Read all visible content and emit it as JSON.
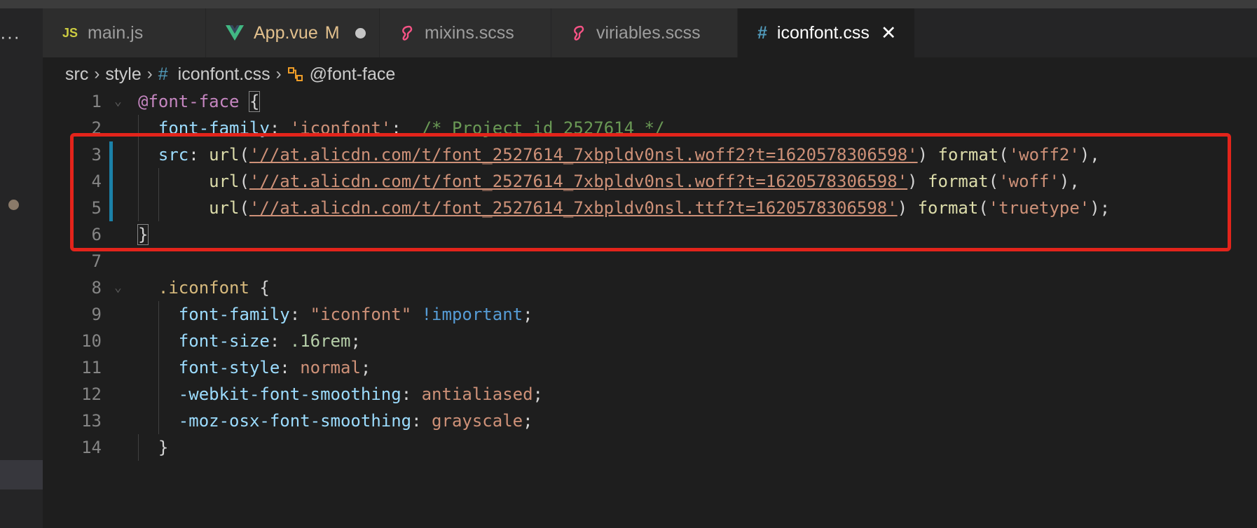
{
  "window": {
    "more_label": "···"
  },
  "tabs": [
    {
      "icon": "js-file-icon",
      "icon_text": "JS",
      "label": "main.js",
      "active": false
    },
    {
      "icon": "vue-file-icon",
      "label": "App.vue",
      "modified_badge": "M",
      "active": false,
      "unsaved": true
    },
    {
      "icon": "sass-file-icon",
      "label": "mixins.scss",
      "active": false
    },
    {
      "icon": "sass-file-icon",
      "label": "viriables.scss",
      "active": false
    },
    {
      "icon": "css-hash-icon",
      "icon_text": "#",
      "label": "iconfont.css",
      "active": true,
      "close_label": "✕"
    }
  ],
  "breadcrumb": {
    "items": [
      "src",
      "style",
      "iconfont.css",
      "@font-face"
    ],
    "separator": "›",
    "hash": "#"
  },
  "editor": {
    "lines": [
      {
        "n": "1",
        "tokens": [
          [
            "kw",
            "@font-face"
          ],
          [
            "pun",
            " "
          ],
          [
            "pun",
            "{"
          ]
        ]
      },
      {
        "n": "2",
        "tokens": [
          [
            "prop",
            "font-family"
          ],
          [
            "pun",
            ": "
          ],
          [
            "str",
            "'iconfont'"
          ],
          [
            "pun",
            ";  "
          ],
          [
            "cmt",
            "/* Project id 2527614 */"
          ]
        ]
      },
      {
        "n": "3",
        "tokens": [
          [
            "prop",
            "src"
          ],
          [
            "pun",
            ": "
          ],
          [
            "fn",
            "url"
          ],
          [
            "pun",
            "("
          ],
          [
            "str",
            "'//at.alicdn.com/t/font_2527614_7xbpldv0nsl.woff2?t=1620578306598'"
          ],
          [
            "pun",
            ") "
          ],
          [
            "fn",
            "format"
          ],
          [
            "pun",
            "("
          ],
          [
            "str",
            "'woff2'"
          ],
          [
            "pun",
            "),"
          ]
        ]
      },
      {
        "n": "4",
        "tokens": [
          [
            "fn",
            "url"
          ],
          [
            "pun",
            "("
          ],
          [
            "str",
            "'//at.alicdn.com/t/font_2527614_7xbpldv0nsl.woff?t=1620578306598'"
          ],
          [
            "pun",
            ") "
          ],
          [
            "fn",
            "format"
          ],
          [
            "pun",
            "("
          ],
          [
            "str",
            "'woff'"
          ],
          [
            "pun",
            "),"
          ]
        ]
      },
      {
        "n": "5",
        "tokens": [
          [
            "fn",
            "url"
          ],
          [
            "pun",
            "("
          ],
          [
            "str",
            "'//at.alicdn.com/t/font_2527614_7xbpldv0nsl.ttf?t=1620578306598'"
          ],
          [
            "pun",
            ") "
          ],
          [
            "fn",
            "format"
          ],
          [
            "pun",
            "("
          ],
          [
            "str",
            "'truetype'"
          ],
          [
            "pun",
            ");"
          ]
        ]
      },
      {
        "n": "6",
        "tokens": [
          [
            "pun",
            "}"
          ]
        ]
      },
      {
        "n": "7",
        "tokens": []
      },
      {
        "n": "8",
        "tokens": [
          [
            "sel",
            ".iconfont"
          ],
          [
            "pun",
            " {"
          ]
        ]
      },
      {
        "n": "9",
        "tokens": [
          [
            "prop",
            "font-family"
          ],
          [
            "pun",
            ": "
          ],
          [
            "str",
            "\"iconfont\""
          ],
          [
            "pun",
            " "
          ],
          [
            "imp",
            "!important"
          ],
          [
            "pun",
            ";"
          ]
        ]
      },
      {
        "n": "10",
        "tokens": [
          [
            "prop",
            "font-size"
          ],
          [
            "pun",
            ": "
          ],
          [
            "num",
            ".16rem"
          ],
          [
            "pun",
            ";"
          ]
        ]
      },
      {
        "n": "11",
        "tokens": [
          [
            "prop",
            "font-style"
          ],
          [
            "pun",
            ": "
          ],
          [
            "str",
            "normal"
          ],
          [
            "pun",
            ";"
          ]
        ]
      },
      {
        "n": "12",
        "tokens": [
          [
            "prop",
            "-webkit-font-smoothing"
          ],
          [
            "pun",
            ": "
          ],
          [
            "str",
            "antialiased"
          ],
          [
            "pun",
            ";"
          ]
        ]
      },
      {
        "n": "13",
        "tokens": [
          [
            "prop",
            "-moz-osx-font-smoothing"
          ],
          [
            "pun",
            ": "
          ],
          [
            "str",
            "grayscale"
          ],
          [
            "pun",
            ";"
          ]
        ]
      },
      {
        "n": "14",
        "tokens": [
          [
            "pun",
            "}"
          ]
        ]
      }
    ]
  },
  "annotation": {
    "color": "#e3241b"
  },
  "colors": {
    "accent": "#1b81a8",
    "editor_bg": "#1e1e1e",
    "tab_bg": "#2d2d2d"
  }
}
